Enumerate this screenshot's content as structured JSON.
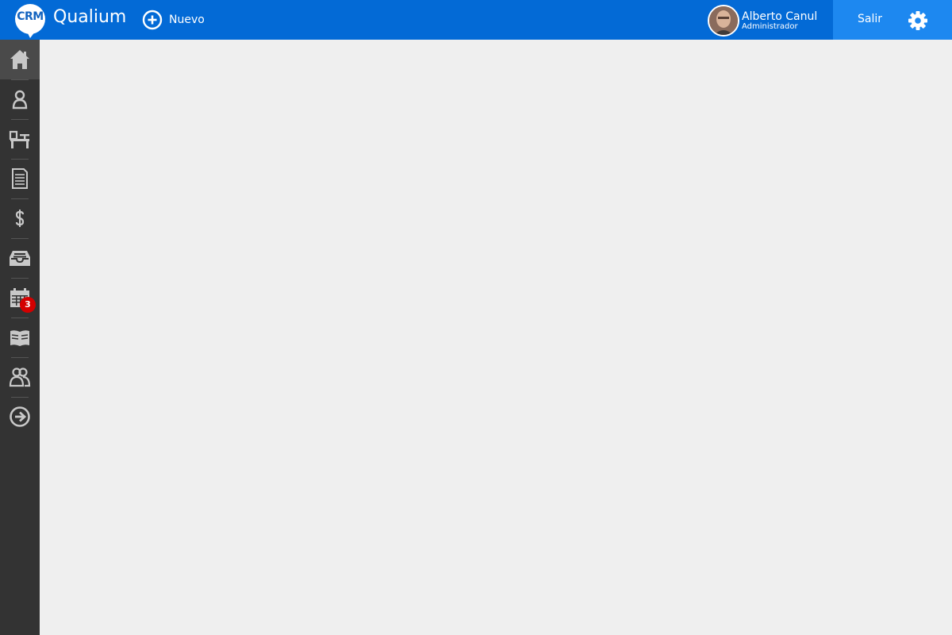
{
  "header": {
    "logo_text": "CRM",
    "brand": "Qualium",
    "new_label": "Nuevo",
    "user_name": "Alberto Canul",
    "user_role": "Administrador",
    "exit_label": "Salir"
  },
  "sidebar": {
    "items": [
      {
        "icon": "home-icon",
        "active": true
      },
      {
        "icon": "user-icon"
      },
      {
        "icon": "desk-icon"
      },
      {
        "icon": "document-icon"
      },
      {
        "icon": "dollar-icon"
      },
      {
        "icon": "inbox-icon"
      },
      {
        "icon": "calendar-icon",
        "badge": "3"
      },
      {
        "icon": "book-icon"
      },
      {
        "icon": "users-icon"
      },
      {
        "icon": "arrow-right-circle-icon"
      }
    ]
  },
  "colors": {
    "topbar": "#036ad6",
    "exit_area": "#1d88f0",
    "sidebar": "#333333",
    "sidebar_active": "#4a4a4a",
    "content_bg": "#efefef",
    "badge": "#d40000",
    "icon": "#c8c8c8"
  }
}
